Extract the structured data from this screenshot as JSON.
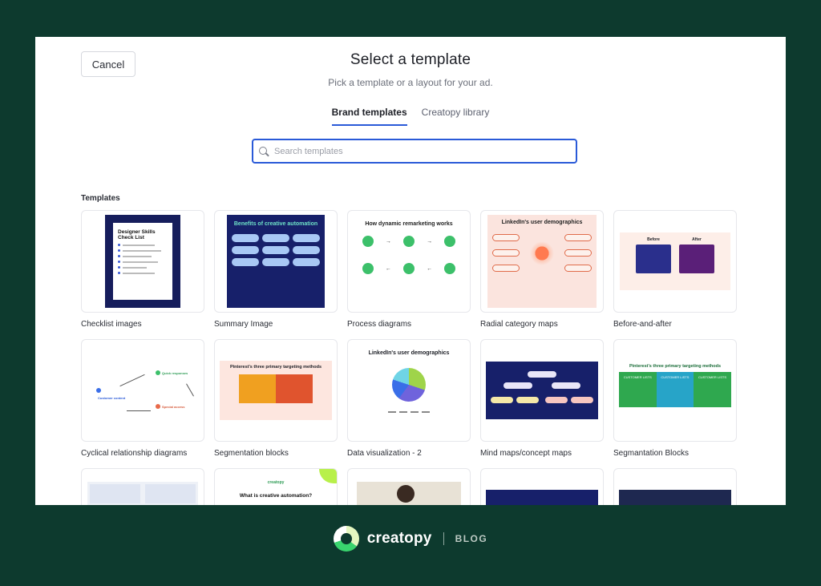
{
  "dialog": {
    "cancel_label": "Cancel",
    "title": "Select a template",
    "subtitle": "Pick a template or a layout for your ad.",
    "tabs": [
      {
        "label": "Brand templates",
        "active": true
      },
      {
        "label": "Creatopy library",
        "active": false
      }
    ],
    "search": {
      "placeholder": "Search templates",
      "value": ""
    },
    "section_label": "Templates",
    "templates": [
      {
        "label": "Checklist images",
        "thumb_title": "Designer Skills Check List"
      },
      {
        "label": "Summary Image",
        "thumb_title": "Benefits of creative automation"
      },
      {
        "label": "Process diagrams",
        "thumb_title": "How dynamic remarketing works"
      },
      {
        "label": "Radial category maps",
        "thumb_title": "LinkedIn's user demographics"
      },
      {
        "label": "Before-and-after",
        "thumb_before": "Before",
        "thumb_after": "After"
      },
      {
        "label": "Cyclical relationship diagrams",
        "thumb_a": "Quick responses",
        "thumb_b": "Customer content",
        "thumb_c": "Special access"
      },
      {
        "label": "Segmentation blocks",
        "thumb_title": "Pinterest's three primary targeting methods"
      },
      {
        "label": "Data visualization - 2",
        "thumb_title": "LinkedIn's user demographics"
      },
      {
        "label": "Mind maps/concept maps"
      },
      {
        "label": "Segmantation Blocks",
        "thumb_title": "Pinterest's three primary targeting methods",
        "cells": [
          "CUSTOMER LISTS",
          "CUSTOMER LISTS",
          "CUSTOMER LISTS"
        ]
      }
    ],
    "partial_row_title": "What is creative automation?"
  },
  "brand": {
    "name": "creatopy",
    "section": "BLOG"
  },
  "colors": {
    "background": "#0d3a2e",
    "accent": "#2a5ad8",
    "navy": "#17206a"
  }
}
